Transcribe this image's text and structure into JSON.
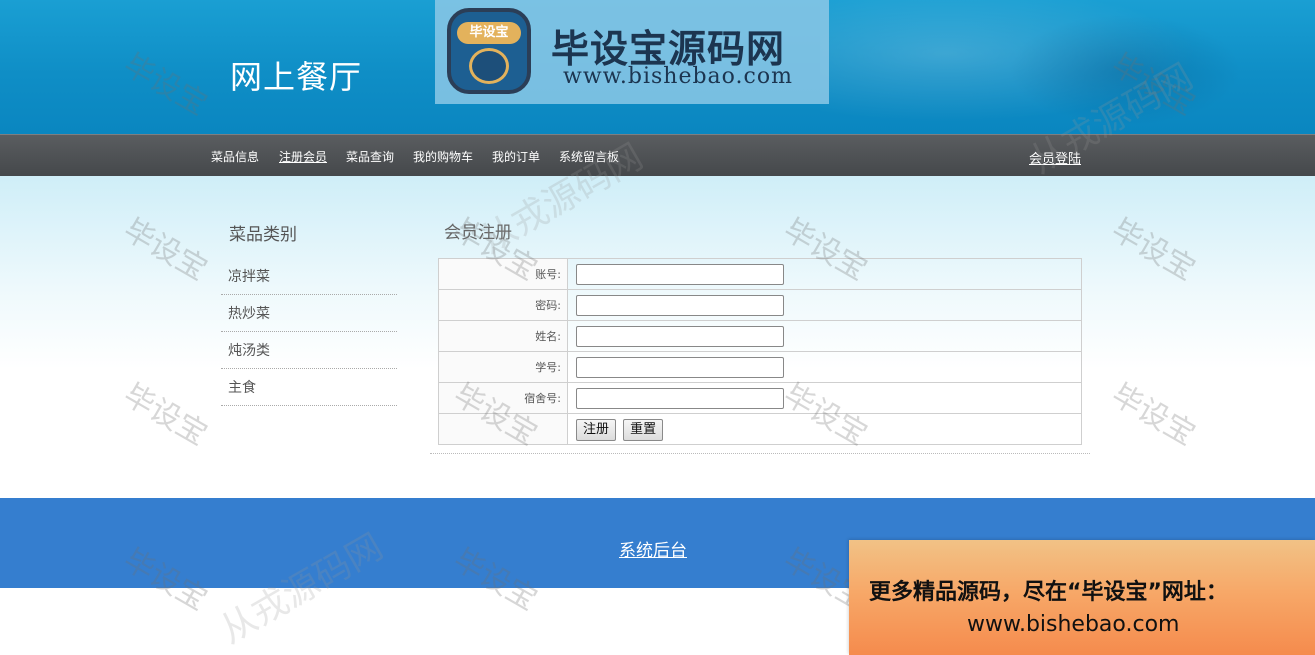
{
  "header": {
    "site_title": "网上餐厅",
    "logo_main": "毕设宝源码网",
    "logo_url": "www.bishebao.com",
    "logo_emblem_text": "毕设宝"
  },
  "nav": {
    "items": [
      {
        "label": "菜品信息"
      },
      {
        "label": "注册会员"
      },
      {
        "label": "菜品查询"
      },
      {
        "label": "我的购物车"
      },
      {
        "label": "我的订单"
      },
      {
        "label": "系统留言板"
      }
    ],
    "login": "会员登陆"
  },
  "sidebar": {
    "title": "菜品类别",
    "categories": [
      {
        "label": "凉拌菜"
      },
      {
        "label": "热炒菜"
      },
      {
        "label": "炖汤类"
      },
      {
        "label": "主食"
      }
    ]
  },
  "form": {
    "title": "会员注册",
    "fields": [
      {
        "label": "账号:",
        "value": ""
      },
      {
        "label": "密码:",
        "value": ""
      },
      {
        "label": "姓名:",
        "value": ""
      },
      {
        "label": "学号:",
        "value": ""
      },
      {
        "label": "宿舍号:",
        "value": ""
      }
    ],
    "submit_label": "注册",
    "reset_label": "重置"
  },
  "footer": {
    "admin_link": "系统后台"
  },
  "ad": {
    "line1": "更多精品源码，尽在“毕设宝”网址：",
    "line2": "www.bishebao.com"
  },
  "watermark": {
    "small": "毕设宝",
    "large": "从戎源码网"
  },
  "colors": {
    "header_blue": "#1a9fd3",
    "nav_gray": "#4e5154",
    "footer_blue": "#357ecf"
  }
}
